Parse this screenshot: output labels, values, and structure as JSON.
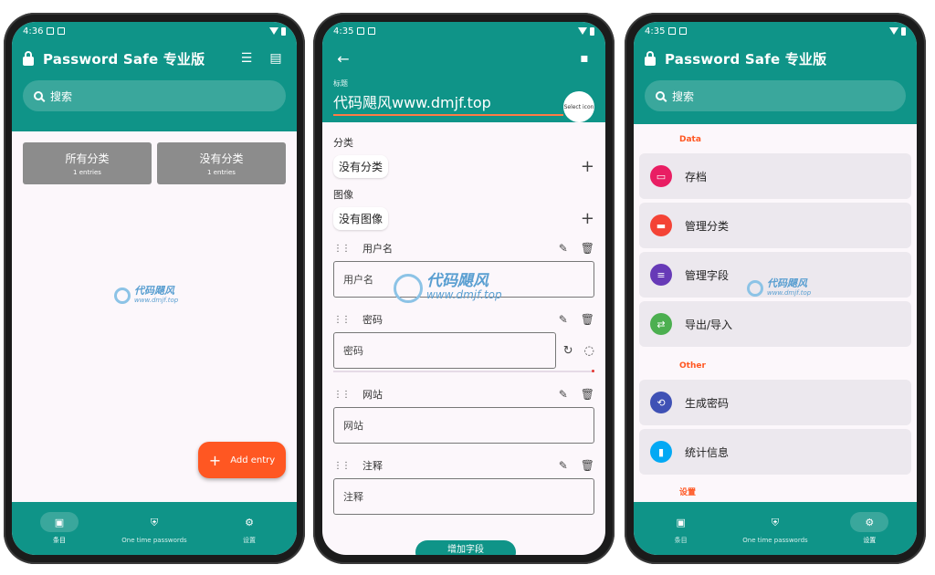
{
  "phone1": {
    "status": {
      "time": "4:36"
    },
    "title": "Password Safe 专业版",
    "search_placeholder": "搜索",
    "categories": [
      {
        "name": "所有分类",
        "count": "1 entries"
      },
      {
        "name": "没有分类",
        "count": "1 entries"
      }
    ],
    "watermark": {
      "brand": "代码飓风",
      "url": "www.dmjf.top"
    },
    "fab_label": "Add entry",
    "nav": [
      {
        "label": "条目",
        "icon": "clipboard-icon"
      },
      {
        "label": "One time passwords",
        "icon": "shield-icon"
      },
      {
        "label": "设置",
        "icon": "gear-icon"
      }
    ]
  },
  "phone2": {
    "status": {
      "time": "4:35"
    },
    "title_label": "标题",
    "title_value": "代码飓风www.dmjf.top",
    "select_icon": "Select icon",
    "category_label": "分类",
    "category_value": "没有分类",
    "image_label": "图像",
    "image_value": "没有图像",
    "fields": [
      {
        "name": "用户名",
        "placeholder": "用户名"
      },
      {
        "name": "密码",
        "placeholder": "密码"
      },
      {
        "name": "网站",
        "placeholder": "网站"
      },
      {
        "name": "注释",
        "placeholder": "注释"
      }
    ],
    "watermark": {
      "brand": "代码飓风",
      "url": "www.dmjf.top"
    },
    "add_field": "增加字段"
  },
  "phone3": {
    "status": {
      "time": "4:35"
    },
    "title": "Password Safe 专业版",
    "search_placeholder": "搜索",
    "group_data": "Data",
    "data_items": [
      {
        "label": "存档",
        "color": "#e91e63",
        "icon": "archive-icon"
      },
      {
        "label": "管理分类",
        "color": "#f44336",
        "icon": "label-icon"
      },
      {
        "label": "管理字段",
        "color": "#673ab7",
        "icon": "list-icon"
      },
      {
        "label": "导出/导入",
        "color": "#4caf50",
        "icon": "swap-icon"
      }
    ],
    "group_other": "Other",
    "other_items": [
      {
        "label": "生成密码",
        "color": "#3f51b5",
        "icon": "repeat-icon"
      },
      {
        "label": "统计信息",
        "color": "#03a9f4",
        "icon": "bar-chart-icon"
      }
    ],
    "group_settings": "设置",
    "watermark": {
      "brand": "代码飓风",
      "url": "www.dmjf.top"
    },
    "nav": [
      {
        "label": "条目",
        "icon": "clipboard-icon"
      },
      {
        "label": "One time passwords",
        "icon": "shield-icon"
      },
      {
        "label": "设置",
        "icon": "gear-icon"
      }
    ]
  }
}
